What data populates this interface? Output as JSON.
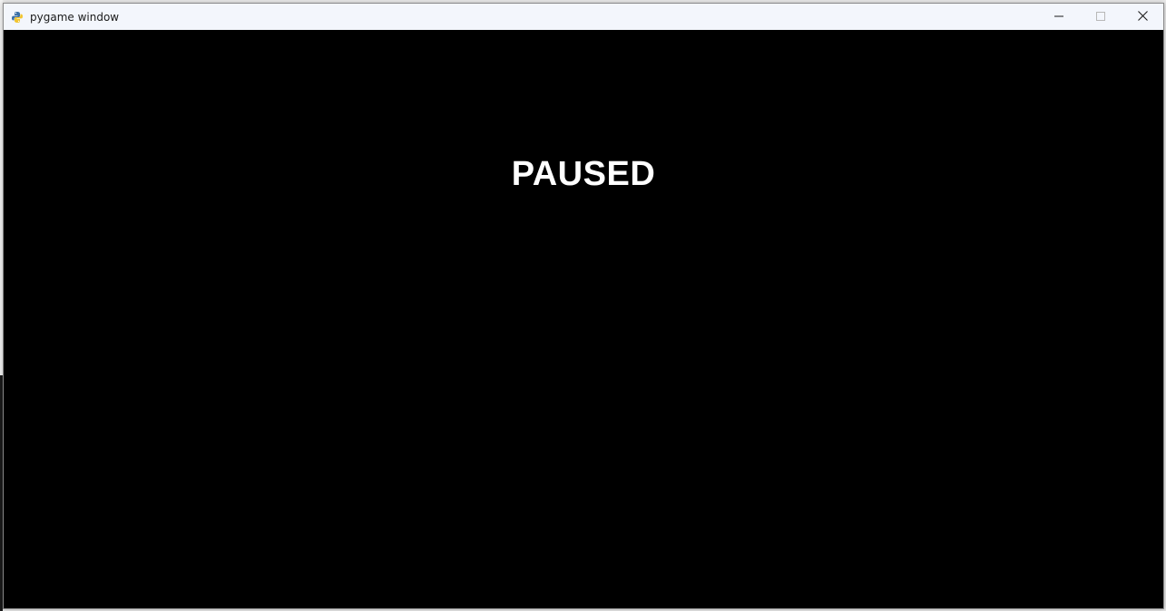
{
  "window": {
    "title": "pygame window",
    "app_icon": "python-snake-icon",
    "controls": {
      "minimize_icon": "minimize-icon",
      "maximize_icon": "maximize-icon",
      "close_icon": "close-icon"
    }
  },
  "game": {
    "status_text": "PAUSED",
    "background_color": "#000000",
    "text_color": "#ffffff"
  }
}
